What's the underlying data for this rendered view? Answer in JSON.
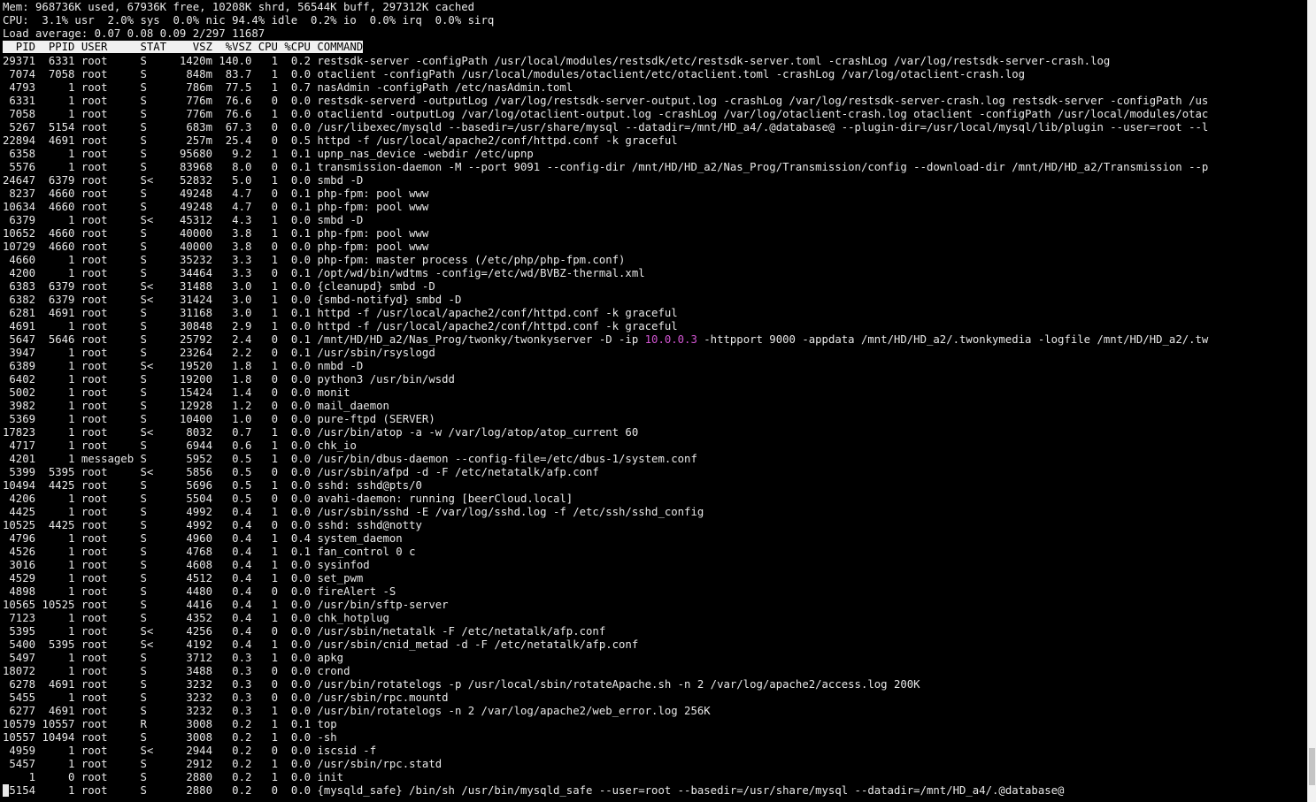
{
  "summary": {
    "mem": "Mem: 968736K used, 67936K free, 10208K shrd, 56544K buff, 297312K cached",
    "cpu": "CPU:  3.1% usr  2.0% sys  0.0% nic 94.4% idle  0.2% io  0.0% irq  0.0% sirq",
    "load": "Load average: 0.07 0.08 0.09 2/297 11687"
  },
  "columns": [
    "PID",
    "PPID",
    "USER",
    "STAT",
    "VSZ",
    "%VSZ",
    "CPU",
    "%CPU",
    "COMMAND"
  ],
  "processes": [
    {
      "pid": "29371",
      "ppid": "6331",
      "user": "root",
      "stat": "S",
      "vsz": "1420m",
      "pvsz": "140.0",
      "cpu": "1",
      "pcpu": "0.2",
      "cmd": "restsdk-server -configPath /usr/local/modules/restsdk/etc/restsdk-server.toml -crashLog /var/log/restsdk-server-crash.log"
    },
    {
      "pid": "7074",
      "ppid": "7058",
      "user": "root",
      "stat": "S",
      "vsz": "848m",
      "pvsz": "83.7",
      "cpu": "1",
      "pcpu": "0.0",
      "cmd": "otaclient -configPath /usr/local/modules/otaclient/etc/otaclient.toml -crashLog /var/log/otaclient-crash.log"
    },
    {
      "pid": "4793",
      "ppid": "1",
      "user": "root",
      "stat": "S",
      "vsz": "786m",
      "pvsz": "77.5",
      "cpu": "1",
      "pcpu": "0.7",
      "cmd": "nasAdmin -configPath /etc/nasAdmin.toml"
    },
    {
      "pid": "6331",
      "ppid": "1",
      "user": "root",
      "stat": "S",
      "vsz": "776m",
      "pvsz": "76.6",
      "cpu": "0",
      "pcpu": "0.0",
      "cmd": "restsdk-serverd -outputLog /var/log/restsdk-server-output.log -crashLog /var/log/restsdk-server-crash.log restsdk-server -configPath /us"
    },
    {
      "pid": "7058",
      "ppid": "1",
      "user": "root",
      "stat": "S",
      "vsz": "776m",
      "pvsz": "76.6",
      "cpu": "1",
      "pcpu": "0.0",
      "cmd": "otaclientd -outputLog /var/log/otaclient-output.log -crashLog /var/log/otaclient-crash.log otaclient -configPath /usr/local/modules/otac"
    },
    {
      "pid": "5267",
      "ppid": "5154",
      "user": "root",
      "stat": "S",
      "vsz": "683m",
      "pvsz": "67.3",
      "cpu": "0",
      "pcpu": "0.0",
      "cmd": "/usr/libexec/mysqld --basedir=/usr/share/mysql --datadir=/mnt/HD_a4/.@database@ --plugin-dir=/usr/local/mysql/lib/plugin --user=root --l"
    },
    {
      "pid": "22894",
      "ppid": "4691",
      "user": "root",
      "stat": "S",
      "vsz": "257m",
      "pvsz": "25.4",
      "cpu": "0",
      "pcpu": "0.5",
      "cmd": "httpd -f /usr/local/apache2/conf/httpd.conf -k graceful"
    },
    {
      "pid": "6358",
      "ppid": "1",
      "user": "root",
      "stat": "S",
      "vsz": "95680",
      "pvsz": "9.2",
      "cpu": "1",
      "pcpu": "0.1",
      "cmd": "upnp_nas_device -webdir /etc/upnp"
    },
    {
      "pid": "5576",
      "ppid": "1",
      "user": "root",
      "stat": "S",
      "vsz": "83968",
      "pvsz": "8.0",
      "cpu": "0",
      "pcpu": "0.1",
      "cmd": "transmission-daemon -M --port 9091 --config-dir /mnt/HD/HD_a2/Nas_Prog/Transmission/config --download-dir /mnt/HD/HD_a2/Transmission --p"
    },
    {
      "pid": "24647",
      "ppid": "6379",
      "user": "root",
      "stat": "S<",
      "vsz": "52832",
      "pvsz": "5.0",
      "cpu": "1",
      "pcpu": "0.0",
      "cmd": "smbd -D"
    },
    {
      "pid": "8237",
      "ppid": "4660",
      "user": "root",
      "stat": "S",
      "vsz": "49248",
      "pvsz": "4.7",
      "cpu": "0",
      "pcpu": "0.1",
      "cmd": "php-fpm: pool www"
    },
    {
      "pid": "10634",
      "ppid": "4660",
      "user": "root",
      "stat": "S",
      "vsz": "49248",
      "pvsz": "4.7",
      "cpu": "0",
      "pcpu": "0.1",
      "cmd": "php-fpm: pool www"
    },
    {
      "pid": "6379",
      "ppid": "1",
      "user": "root",
      "stat": "S<",
      "vsz": "45312",
      "pvsz": "4.3",
      "cpu": "1",
      "pcpu": "0.0",
      "cmd": "smbd -D"
    },
    {
      "pid": "10652",
      "ppid": "4660",
      "user": "root",
      "stat": "S",
      "vsz": "40000",
      "pvsz": "3.8",
      "cpu": "1",
      "pcpu": "0.1",
      "cmd": "php-fpm: pool www"
    },
    {
      "pid": "10729",
      "ppid": "4660",
      "user": "root",
      "stat": "S",
      "vsz": "40000",
      "pvsz": "3.8",
      "cpu": "0",
      "pcpu": "0.0",
      "cmd": "php-fpm: pool www"
    },
    {
      "pid": "4660",
      "ppid": "1",
      "user": "root",
      "stat": "S",
      "vsz": "35232",
      "pvsz": "3.3",
      "cpu": "1",
      "pcpu": "0.0",
      "cmd": "php-fpm: master process (/etc/php/php-fpm.conf)"
    },
    {
      "pid": "4200",
      "ppid": "1",
      "user": "root",
      "stat": "S",
      "vsz": "34464",
      "pvsz": "3.3",
      "cpu": "0",
      "pcpu": "0.1",
      "cmd": "/opt/wd/bin/wdtms -config=/etc/wd/BVBZ-thermal.xml"
    },
    {
      "pid": "6383",
      "ppid": "6379",
      "user": "root",
      "stat": "S<",
      "vsz": "31488",
      "pvsz": "3.0",
      "cpu": "1",
      "pcpu": "0.0",
      "cmd": "{cleanupd} smbd -D"
    },
    {
      "pid": "6382",
      "ppid": "6379",
      "user": "root",
      "stat": "S<",
      "vsz": "31424",
      "pvsz": "3.0",
      "cpu": "1",
      "pcpu": "0.0",
      "cmd": "{smbd-notifyd} smbd -D"
    },
    {
      "pid": "6281",
      "ppid": "4691",
      "user": "root",
      "stat": "S",
      "vsz": "31168",
      "pvsz": "3.0",
      "cpu": "1",
      "pcpu": "0.1",
      "cmd": "httpd -f /usr/local/apache2/conf/httpd.conf -k graceful"
    },
    {
      "pid": "4691",
      "ppid": "1",
      "user": "root",
      "stat": "S",
      "vsz": "30848",
      "pvsz": "2.9",
      "cpu": "1",
      "pcpu": "0.0",
      "cmd": "httpd -f /usr/local/apache2/conf/httpd.conf -k graceful"
    },
    {
      "pid": "5647",
      "ppid": "5646",
      "user": "root",
      "stat": "S",
      "vsz": "25792",
      "pvsz": "2.4",
      "cpu": "0",
      "pcpu": "0.1",
      "cmd": "/mnt/HD/HD_a2/Nas_Prog/twonky/twonkyserver -D -ip ",
      "ip": "10.0.0.3",
      "cmd_after": " -httpport 9000 -appdata /mnt/HD/HD_a2/.twonkymedia -logfile /mnt/HD/HD_a2/.tw"
    },
    {
      "pid": "3947",
      "ppid": "1",
      "user": "root",
      "stat": "S",
      "vsz": "23264",
      "pvsz": "2.2",
      "cpu": "0",
      "pcpu": "0.1",
      "cmd": "/usr/sbin/rsyslogd"
    },
    {
      "pid": "6389",
      "ppid": "1",
      "user": "root",
      "stat": "S<",
      "vsz": "19520",
      "pvsz": "1.8",
      "cpu": "1",
      "pcpu": "0.0",
      "cmd": "nmbd -D"
    },
    {
      "pid": "6402",
      "ppid": "1",
      "user": "root",
      "stat": "S",
      "vsz": "19200",
      "pvsz": "1.8",
      "cpu": "0",
      "pcpu": "0.0",
      "cmd": "python3 /usr/bin/wsdd"
    },
    {
      "pid": "5002",
      "ppid": "1",
      "user": "root",
      "stat": "S",
      "vsz": "15424",
      "pvsz": "1.4",
      "cpu": "0",
      "pcpu": "0.0",
      "cmd": "monit"
    },
    {
      "pid": "3982",
      "ppid": "1",
      "user": "root",
      "stat": "S",
      "vsz": "12928",
      "pvsz": "1.2",
      "cpu": "0",
      "pcpu": "0.0",
      "cmd": "mail_daemon"
    },
    {
      "pid": "5369",
      "ppid": "1",
      "user": "root",
      "stat": "S",
      "vsz": "10400",
      "pvsz": "1.0",
      "cpu": "0",
      "pcpu": "0.0",
      "cmd": "pure-ftpd (SERVER)"
    },
    {
      "pid": "17823",
      "ppid": "1",
      "user": "root",
      "stat": "S<",
      "vsz": "8032",
      "pvsz": "0.7",
      "cpu": "1",
      "pcpu": "0.0",
      "cmd": "/usr/bin/atop -a -w /var/log/atop/atop_current 60"
    },
    {
      "pid": "4717",
      "ppid": "1",
      "user": "root",
      "stat": "S",
      "vsz": "6944",
      "pvsz": "0.6",
      "cpu": "1",
      "pcpu": "0.0",
      "cmd": "chk_io"
    },
    {
      "pid": "4201",
      "ppid": "1",
      "user": "messageb",
      "stat": "S",
      "vsz": "5952",
      "pvsz": "0.5",
      "cpu": "1",
      "pcpu": "0.0",
      "cmd": "/usr/bin/dbus-daemon --config-file=/etc/dbus-1/system.conf"
    },
    {
      "pid": "5399",
      "ppid": "5395",
      "user": "root",
      "stat": "S<",
      "vsz": "5856",
      "pvsz": "0.5",
      "cpu": "0",
      "pcpu": "0.0",
      "cmd": "/usr/sbin/afpd -d -F /etc/netatalk/afp.conf"
    },
    {
      "pid": "10494",
      "ppid": "4425",
      "user": "root",
      "stat": "S",
      "vsz": "5696",
      "pvsz": "0.5",
      "cpu": "1",
      "pcpu": "0.0",
      "cmd": "sshd: sshd@pts/0"
    },
    {
      "pid": "4206",
      "ppid": "1",
      "user": "root",
      "stat": "S",
      "vsz": "5504",
      "pvsz": "0.5",
      "cpu": "0",
      "pcpu": "0.0",
      "cmd": "avahi-daemon: running [beerCloud.local]"
    },
    {
      "pid": "4425",
      "ppid": "1",
      "user": "root",
      "stat": "S",
      "vsz": "4992",
      "pvsz": "0.4",
      "cpu": "1",
      "pcpu": "0.0",
      "cmd": "/usr/sbin/sshd -E /var/log/sshd.log -f /etc/ssh/sshd_config"
    },
    {
      "pid": "10525",
      "ppid": "4425",
      "user": "root",
      "stat": "S",
      "vsz": "4992",
      "pvsz": "0.4",
      "cpu": "0",
      "pcpu": "0.0",
      "cmd": "sshd: sshd@notty"
    },
    {
      "pid": "4796",
      "ppid": "1",
      "user": "root",
      "stat": "S",
      "vsz": "4960",
      "pvsz": "0.4",
      "cpu": "1",
      "pcpu": "0.4",
      "cmd": "system_daemon"
    },
    {
      "pid": "4526",
      "ppid": "1",
      "user": "root",
      "stat": "S",
      "vsz": "4768",
      "pvsz": "0.4",
      "cpu": "1",
      "pcpu": "0.1",
      "cmd": "fan_control 0 c"
    },
    {
      "pid": "3016",
      "ppid": "1",
      "user": "root",
      "stat": "S",
      "vsz": "4608",
      "pvsz": "0.4",
      "cpu": "1",
      "pcpu": "0.0",
      "cmd": "sysinfod"
    },
    {
      "pid": "4529",
      "ppid": "1",
      "user": "root",
      "stat": "S",
      "vsz": "4512",
      "pvsz": "0.4",
      "cpu": "1",
      "pcpu": "0.0",
      "cmd": "set_pwm"
    },
    {
      "pid": "4898",
      "ppid": "1",
      "user": "root",
      "stat": "S",
      "vsz": "4480",
      "pvsz": "0.4",
      "cpu": "0",
      "pcpu": "0.0",
      "cmd": "fireAlert -S"
    },
    {
      "pid": "10565",
      "ppid": "10525",
      "user": "root",
      "stat": "S",
      "vsz": "4416",
      "pvsz": "0.4",
      "cpu": "1",
      "pcpu": "0.0",
      "cmd": "/usr/bin/sftp-server"
    },
    {
      "pid": "7123",
      "ppid": "1",
      "user": "root",
      "stat": "S",
      "vsz": "4352",
      "pvsz": "0.4",
      "cpu": "1",
      "pcpu": "0.0",
      "cmd": "chk_hotplug"
    },
    {
      "pid": "5395",
      "ppid": "1",
      "user": "root",
      "stat": "S<",
      "vsz": "4256",
      "pvsz": "0.4",
      "cpu": "0",
      "pcpu": "0.0",
      "cmd": "/usr/sbin/netatalk -F /etc/netatalk/afp.conf"
    },
    {
      "pid": "5400",
      "ppid": "5395",
      "user": "root",
      "stat": "S<",
      "vsz": "4192",
      "pvsz": "0.4",
      "cpu": "1",
      "pcpu": "0.0",
      "cmd": "/usr/sbin/cnid_metad -d -F /etc/netatalk/afp.conf"
    },
    {
      "pid": "5497",
      "ppid": "1",
      "user": "root",
      "stat": "S",
      "vsz": "3712",
      "pvsz": "0.3",
      "cpu": "1",
      "pcpu": "0.0",
      "cmd": "apkg"
    },
    {
      "pid": "18072",
      "ppid": "1",
      "user": "root",
      "stat": "S",
      "vsz": "3488",
      "pvsz": "0.3",
      "cpu": "0",
      "pcpu": "0.0",
      "cmd": "crond"
    },
    {
      "pid": "6278",
      "ppid": "4691",
      "user": "root",
      "stat": "S",
      "vsz": "3232",
      "pvsz": "0.3",
      "cpu": "0",
      "pcpu": "0.0",
      "cmd": "/usr/bin/rotatelogs -p /usr/local/sbin/rotateApache.sh -n 2 /var/log/apache2/access.log 200K"
    },
    {
      "pid": "5455",
      "ppid": "1",
      "user": "root",
      "stat": "S",
      "vsz": "3232",
      "pvsz": "0.3",
      "cpu": "0",
      "pcpu": "0.0",
      "cmd": "/usr/sbin/rpc.mountd"
    },
    {
      "pid": "6277",
      "ppid": "4691",
      "user": "root",
      "stat": "S",
      "vsz": "3232",
      "pvsz": "0.3",
      "cpu": "1",
      "pcpu": "0.0",
      "cmd": "/usr/bin/rotatelogs -n 2 /var/log/apache2/web_error.log 256K"
    },
    {
      "pid": "10579",
      "ppid": "10557",
      "user": "root",
      "stat": "R",
      "vsz": "3008",
      "pvsz": "0.2",
      "cpu": "1",
      "pcpu": "0.1",
      "cmd": "top"
    },
    {
      "pid": "10557",
      "ppid": "10494",
      "user": "root",
      "stat": "S",
      "vsz": "3008",
      "pvsz": "0.2",
      "cpu": "1",
      "pcpu": "0.0",
      "cmd": "-sh"
    },
    {
      "pid": "4959",
      "ppid": "1",
      "user": "root",
      "stat": "S<",
      "vsz": "2944",
      "pvsz": "0.2",
      "cpu": "0",
      "pcpu": "0.0",
      "cmd": "iscsid -f"
    },
    {
      "pid": "5457",
      "ppid": "1",
      "user": "root",
      "stat": "S",
      "vsz": "2912",
      "pvsz": "0.2",
      "cpu": "1",
      "pcpu": "0.0",
      "cmd": "/usr/sbin/rpc.statd"
    },
    {
      "pid": "1",
      "ppid": "0",
      "user": "root",
      "stat": "S",
      "vsz": "2880",
      "pvsz": "0.2",
      "cpu": "1",
      "pcpu": "0.0",
      "cmd": "init"
    },
    {
      "pid": "5154",
      "ppid": "1",
      "user": "root",
      "stat": "S",
      "vsz": "2880",
      "pvsz": "0.2",
      "cpu": "0",
      "pcpu": "0.0",
      "cmd": "{mysqld_safe} /bin/sh /usr/bin/mysqld_safe --user=root --basedir=/usr/share/mysql --datadir=/mnt/HD_a4/.@database@"
    }
  ],
  "colors": {
    "background": "#000000",
    "foreground": "#e8e8e8",
    "highlight": "#d255d2",
    "header_bg": "#f0f0f0"
  }
}
